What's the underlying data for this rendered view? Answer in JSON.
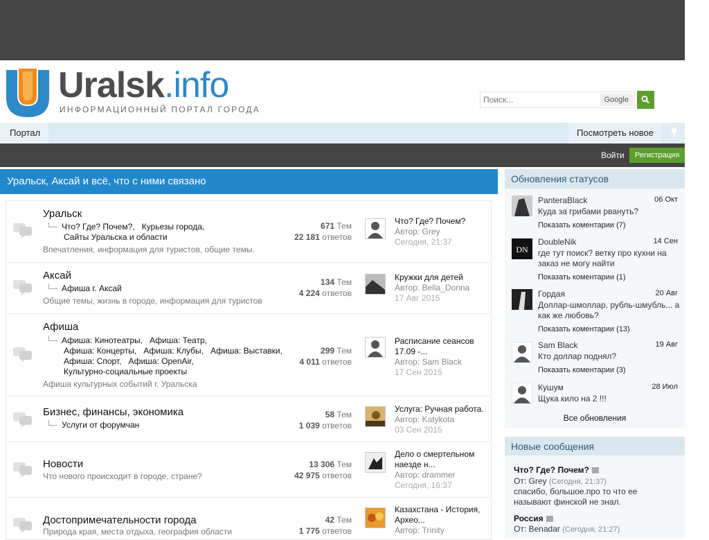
{
  "header": {
    "logo_main": "Uralsk",
    "logo_dot": ".info",
    "logo_sub": "ИНФОРМАЦИОННЫЙ ПОРТАЛ ГОРОДА",
    "search_placeholder": "Поиск...",
    "search_engine": "Google"
  },
  "nav": {
    "portal": "Портал",
    "new": "Посмотреть новое"
  },
  "auth": {
    "login": "Войти",
    "register": "Регистрация"
  },
  "main": {
    "title": "Уральск, Аксай и всё, что с ними связано",
    "forums": [
      {
        "title": "Уральск",
        "subs": [
          "Что? Где? Почем?,",
          "Курьезы города,",
          "Сайты Уральска и области"
        ],
        "desc": "Впечатления, информация для туристов, общие темы.",
        "topics": "671",
        "topics_label": "Тем",
        "replies": "22 181",
        "replies_label": "ответов",
        "lp_title": "Что? Где? Почем?",
        "lp_author": "Автор: Grey",
        "lp_date": "Сегодня, 21:37"
      },
      {
        "title": "Аксай",
        "subs": [
          "Афиша г. Аксай"
        ],
        "desc": "Общие темы, жизнь в городе, информация для туристов",
        "topics": "134",
        "topics_label": "Тем",
        "replies": "4 224",
        "replies_label": "ответов",
        "lp_title": "Кружки для детей",
        "lp_author": "Автор: Bella_Donna",
        "lp_date": "17 Авг 2015"
      },
      {
        "title": "Афиша",
        "subs": [
          "Афиша: Кинотеатры,",
          "Афиша: Театр,",
          "Афиша: Концерты,",
          "Афиша: Клубы,",
          "Афиша: Выставки,",
          "Афиша: Спорт,",
          "Афиша: OpenAir,",
          "Культурно-социальные проекты"
        ],
        "desc": "Афиша культурных событий г. Уральска",
        "topics": "299",
        "topics_label": "Тем",
        "replies": "4 011",
        "replies_label": "ответов",
        "lp_title": "Расписание сеансов 17.09 -...",
        "lp_author": "Автор: Sam Black",
        "lp_date": "17 Сен 2015"
      },
      {
        "title": "Бизнес, финансы, экономика",
        "subs": [
          "Услуги от форумчан"
        ],
        "desc": "",
        "topics": "58",
        "topics_label": "Тем",
        "replies": "1 039",
        "replies_label": "ответов",
        "lp_title": "Услуга: Ручная работа.",
        "lp_author": "Автор: Katykota",
        "lp_date": "03 Сен 2015"
      },
      {
        "title": "Новости",
        "subs": [],
        "desc": "Что нового происходит в городе, стране?",
        "topics": "13 306",
        "topics_label": "Тем",
        "replies": "42 975",
        "replies_label": "ответов",
        "lp_title": "Дело о смертельном наезде н...",
        "lp_author": "Автор: drammer",
        "lp_date": "Сегодня, 16:37"
      },
      {
        "title": "Достопримечательности города",
        "subs": [],
        "desc": "Природа края, места отдыха, география области",
        "topics": "42",
        "topics_label": "Тем",
        "replies": "1 775",
        "replies_label": "ответов",
        "lp_title": "Казахстана - История, Архео...",
        "lp_author": "Автор: Trinity",
        "lp_date": ""
      }
    ]
  },
  "statuses": {
    "title": "Обновления статусов",
    "items": [
      {
        "name": "PanteraBlack",
        "date": "06 Окт",
        "text": "Куда за грибами рвануть?",
        "more": "Показать коментарии (7)"
      },
      {
        "name": "DoubleNik",
        "date": "14 Сен",
        "text": "где тут поиск? ветку про кухни на заказ не могу найти",
        "more": "Показать коментарии (1)"
      },
      {
        "name": "Гордая",
        "date": "20 Авг",
        "text": "Доллар-шмоллар, рубль-шмубль... а как же любовь?",
        "more": "Показать коментарии (13)"
      },
      {
        "name": "Sam Black",
        "date": "19 Авг",
        "text": "Кто доллар поднял?",
        "more": "Показать коментарии (3)"
      },
      {
        "name": "Кушум",
        "date": "28 Июл",
        "text": "Щука кило на 2 !!!",
        "more": ""
      }
    ],
    "all": "Все обновления"
  },
  "messages": {
    "title": "Новые сообщения",
    "items": [
      {
        "title": "Что? Где? Почем?",
        "from": "От: Grey",
        "date": "(Сегодня, 21:37)",
        "text": "спасибо, большое.про то что ее называют финской не знал."
      },
      {
        "title": "Россия",
        "from": "От: Benadar",
        "date": "(Сегодня, 21:27)",
        "text": ""
      }
    ]
  },
  "colors": {
    "accent_blue": "#2288cc",
    "accent_green": "#5e9e2c",
    "dark_bar": "#444444"
  }
}
